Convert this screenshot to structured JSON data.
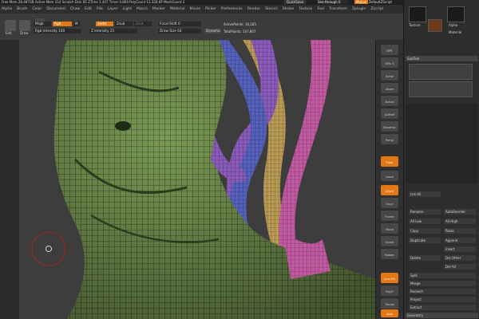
{
  "statusbar": {
    "info": "Free Mem 28.487GB  Active Mem 314  Scratch Disk 85  ZTime 1.447  Timer 0.869  PolyCount 13.328 KP  MeshCount 2",
    "quicksave": "QuickSave",
    "seethrough": "See-through  0",
    "menus": "Menus",
    "script": "DefaultZScript"
  },
  "menubar": {
    "items": [
      "Alpha",
      "Brush",
      "Color",
      "Document",
      "Draw",
      "Edit",
      "File",
      "Layer",
      "Light",
      "Macro",
      "Marker",
      "Material",
      "Movie",
      "Picker",
      "Preferences",
      "Render",
      "Stencil",
      "Stroke",
      "Texture",
      "Tool",
      "Transform",
      "Zplugin",
      "Zscript"
    ]
  },
  "toolbar": {
    "edit": "Edit",
    "draw": "Draw",
    "move": "Move",
    "scale": "Scale",
    "rotate": "Rotate",
    "mrgb": "Mrgb",
    "rgb": "Rgb",
    "m": "M",
    "rgb_intensity": "Rgb Intensity 100",
    "zadd": "Zadd",
    "zsub": "Zsub",
    "zcut": "Zcut",
    "z_intensity": "Z Intensity 25",
    "focal_shift": "Focal Shift 0",
    "draw_size": "Draw Size 64",
    "dynamic": "Dynamic",
    "active_points": "ActivePoints: 16,185",
    "total_points": "TotalPoints: 147,807"
  },
  "right_tools": [
    "BPR",
    "SPix 3",
    "Scroll",
    "Zoom",
    "Actual",
    "AAHalf",
    "Dynamic",
    "Persp",
    "Floor",
    "Local",
    "LSym",
    "Gxyz",
    "Frame",
    "Move",
    "Scale",
    "Rotate",
    "Line Fill",
    "PolyF",
    "Transp",
    "Ghost",
    "Solo",
    "Xpose"
  ],
  "right_panel": {
    "texture_label": "Texture",
    "alpha_label": "Alpha",
    "material_label": "Material",
    "subtool_title": "SubTool",
    "list_all": "List All",
    "buttons": [
      [
        "Rename",
        "AutoReorder"
      ],
      [
        "All Low",
        "All High"
      ],
      [
        "Copy",
        "Paste"
      ],
      [
        "Duplicate",
        "Append"
      ],
      [
        "",
        "Insert"
      ],
      [
        "Delete",
        "Del Other"
      ],
      [
        "",
        "Del All"
      ],
      [
        "Split",
        ""
      ],
      [
        "Merge",
        ""
      ],
      [
        "Remesh",
        ""
      ],
      [
        "Project",
        ""
      ],
      [
        "Extract",
        ""
      ]
    ],
    "geometry": "Geometry"
  },
  "colors": {
    "accent": "#e07a18",
    "mesh_green": "#7a9a55",
    "strand_blue": "#5560b8",
    "strand_pink": "#c05aa0",
    "strand_purple": "#8a5ab8",
    "strand_tan": "#b89a55"
  }
}
